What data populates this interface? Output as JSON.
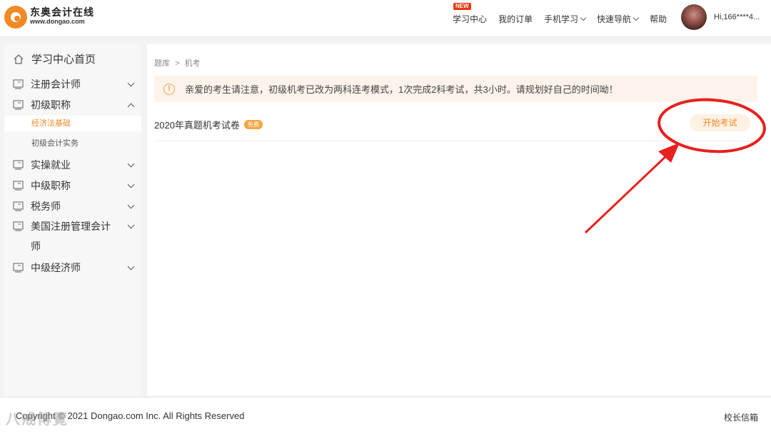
{
  "header": {
    "logo_name": "东奥会计在线",
    "logo_url": "www.dongao.com",
    "nav": [
      {
        "label": "学习中心",
        "badge": "NEW",
        "dropdown": false
      },
      {
        "label": "我的订单",
        "dropdown": false
      },
      {
        "label": "手机学习",
        "dropdown": true
      },
      {
        "label": "快速导航",
        "dropdown": true
      },
      {
        "label": "帮助",
        "dropdown": false
      }
    ],
    "user_name": "Hi,166****4..."
  },
  "sidebar": {
    "home": "学习中心首页",
    "items": [
      {
        "label": "注册会计师",
        "expanded": false
      },
      {
        "label": "初级职称",
        "expanded": true
      },
      {
        "label": "实操就业",
        "expanded": false
      },
      {
        "label": "中级职称",
        "expanded": false
      },
      {
        "label": "税务师",
        "expanded": false
      },
      {
        "label": "美国注册管理会计",
        "label2": "师",
        "expanded": false
      },
      {
        "label": "中级经济师",
        "expanded": false
      }
    ],
    "sub_items": [
      {
        "label": "经济法基础",
        "active": true
      },
      {
        "label": "初级会计实务",
        "active": false
      }
    ]
  },
  "main": {
    "breadcrumb": [
      "题库",
      ">",
      "机考"
    ],
    "notice": "亲爱的考生请注意，初级机考已改为两科连考模式，1次完成2科考试，共3小时。请规划好自己的时间呦！",
    "exam": {
      "title": "2020年真题机考试卷",
      "badge": "免费",
      "button": "开始考试"
    }
  },
  "footer": {
    "copyright": "Copyright © 2021 Dongao.com Inc. All Rights Reserved",
    "mailbox": "校长信箱",
    "watermark": "八戒博覽"
  },
  "colors": {
    "accent": "#f08a24",
    "notice_bg": "#fdf3ea",
    "annotation": "#e8201e"
  }
}
